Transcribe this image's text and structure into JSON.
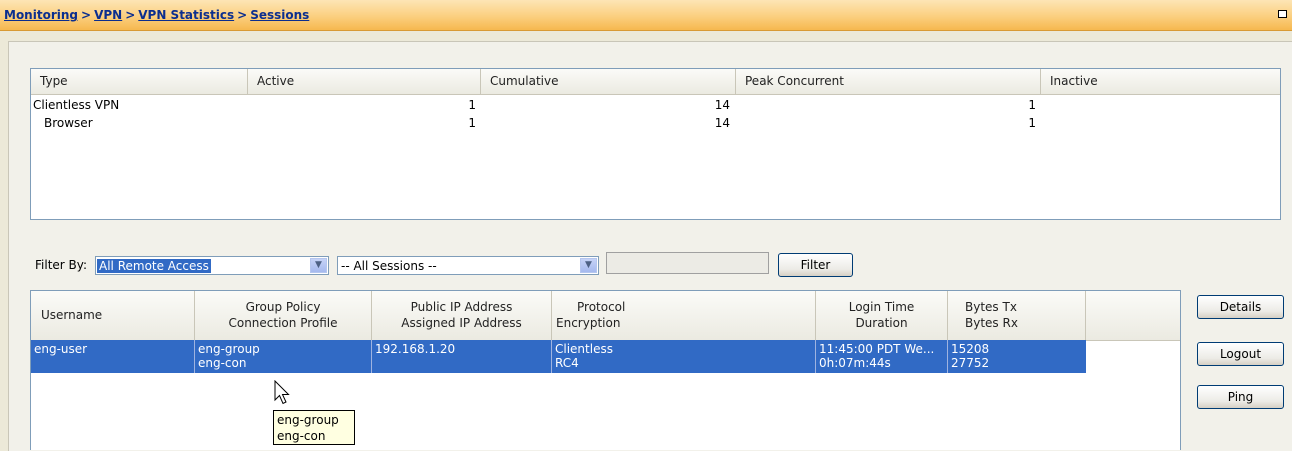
{
  "breadcrumb": {
    "items": [
      "Monitoring",
      "VPN",
      "VPN Statistics",
      "Sessions"
    ],
    "separator": ">"
  },
  "stats_table": {
    "headers": [
      "Type",
      "Active",
      "Cumulative",
      "Peak Concurrent",
      "Inactive"
    ],
    "rows": [
      {
        "type": "Clientless VPN",
        "active": "1",
        "cumulative": "14",
        "peak": "1",
        "inactive": ""
      },
      {
        "type": "Browser",
        "active": "1",
        "cumulative": "14",
        "peak": "1",
        "inactive": ""
      }
    ]
  },
  "filter": {
    "label": "Filter By:",
    "access_value": "All Remote Access",
    "session_value": "-- All Sessions --",
    "text_value": "",
    "button": "Filter"
  },
  "sessions_table": {
    "headers": [
      {
        "line1": "Username",
        "line2": ""
      },
      {
        "line1": "Group Policy",
        "line2": "Connection Profile"
      },
      {
        "line1": "Public IP Address",
        "line2": "Assigned IP Address"
      },
      {
        "line1": "Protocol",
        "line2": "Encryption"
      },
      {
        "line1": "Login Time",
        "line2": "Duration"
      },
      {
        "line1": "Bytes Tx",
        "line2": "Bytes Rx"
      }
    ],
    "rows": [
      {
        "username": "eng-user",
        "group_policy": "eng-group",
        "connection_profile": "eng-con",
        "public_ip": "192.168.1.20",
        "assigned_ip": "",
        "protocol": "Clientless",
        "encryption": "RC4",
        "login_time": "11:45:00 PDT We...",
        "duration": "0h:07m:44s",
        "bytes_tx": "15208",
        "bytes_rx": "27752"
      }
    ]
  },
  "actions": {
    "details": "Details",
    "logout": "Logout",
    "ping": "Ping"
  },
  "tooltip": {
    "line1": "eng-group",
    "line2": "eng-con"
  },
  "colors": {
    "header_orange": "#f6b84f",
    "breadcrumb_link": "#0b2e8f",
    "selection_blue": "#316ac5"
  }
}
